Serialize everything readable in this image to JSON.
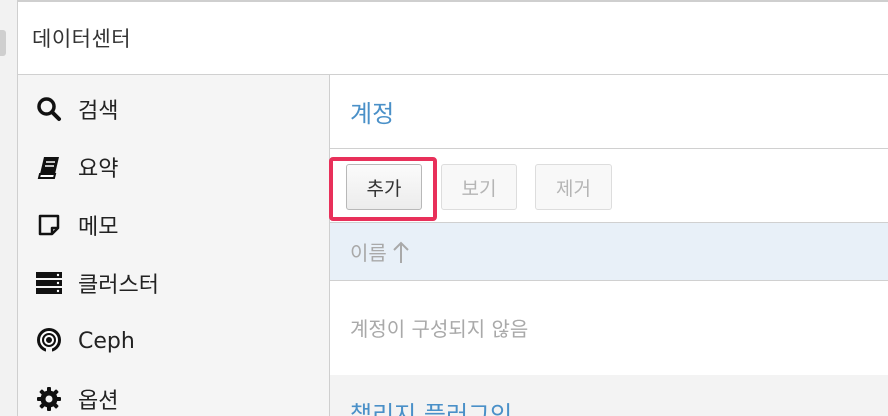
{
  "header": {
    "title": "데이터센터"
  },
  "sidebar": {
    "items": [
      {
        "label": "검색",
        "icon": "search-icon"
      },
      {
        "label": "요약",
        "icon": "book-icon"
      },
      {
        "label": "메모",
        "icon": "note-icon"
      },
      {
        "label": "클러스터",
        "icon": "server-icon"
      },
      {
        "label": "Ceph",
        "icon": "ceph-icon"
      },
      {
        "label": "옵션",
        "icon": "gear-icon"
      }
    ]
  },
  "main": {
    "panel_title": "계정",
    "toolbar": {
      "add": "추가",
      "view": "보기",
      "remove": "제거"
    },
    "grid": {
      "column_name": "이름",
      "empty_text": "계정이 구성되지 않음"
    },
    "next_section_title": "챌리지 플러그인"
  },
  "colors": {
    "accent": "#4a90c8",
    "highlight": "#e8305a",
    "grid_header_bg": "#e8f0f8"
  }
}
